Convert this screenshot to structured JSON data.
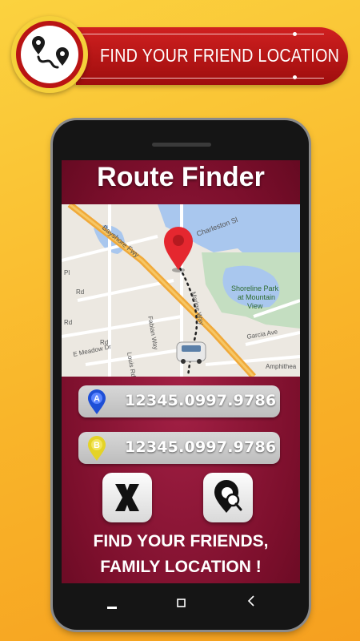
{
  "banner": {
    "title": "FIND YOUR FRIEND LOCATION",
    "badge_icon": "route-icon"
  },
  "app": {
    "title": "Route Finder"
  },
  "map": {
    "labels": {
      "road1": "Bayshore Fwy",
      "road2": "Charleston Sl",
      "park": "Shoreline Park at Mountain View",
      "road3": "Marine Way",
      "road4": "Fabian Way",
      "road5": "E Meadow Dr",
      "road6": "Louis Rd",
      "road7": "Garcia Ave",
      "road8": "Amphithea",
      "pl1": "Pl",
      "rd1": "Rd",
      "rd2": "Rd",
      "rd3": "Rd"
    },
    "pin_icon": "map-pin-icon",
    "car_icon": "car-icon"
  },
  "coords": {
    "a": {
      "letter": "A",
      "value": "12345.0997.9786",
      "color": "#1e4fd6"
    },
    "b": {
      "letter": "B",
      "value": "12345.0997.9786",
      "color": "#e4d327"
    }
  },
  "buttons": {
    "close_icon": "close-icon",
    "search_icon": "location-search-icon"
  },
  "tagline": {
    "line1": "FIND YOUR FRIENDS,",
    "line2": "FAMILY LOCATION !"
  },
  "navbar": {
    "back": "back-icon",
    "home": "home-icon",
    "recent": "recent-apps-icon"
  }
}
